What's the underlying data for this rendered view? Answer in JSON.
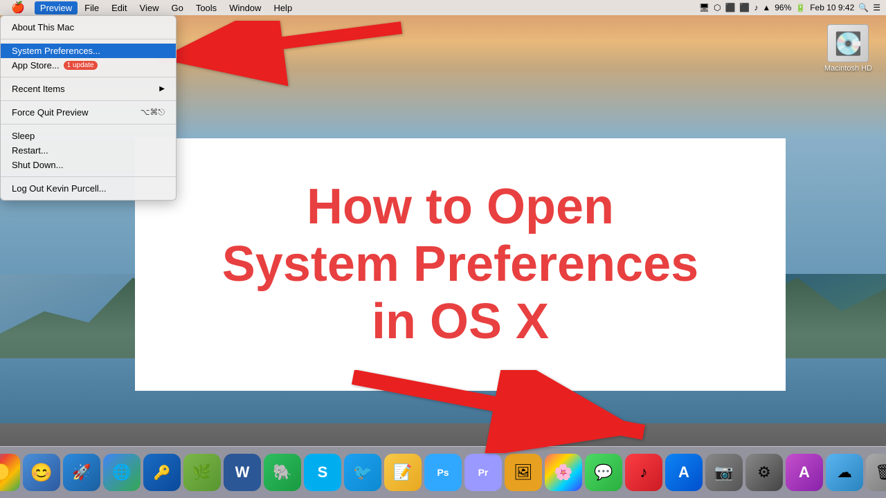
{
  "menubar": {
    "apple": "🍎",
    "appName": "Preview",
    "menus": [
      "File",
      "Edit",
      "View",
      "Go",
      "Tools",
      "Window",
      "Help"
    ],
    "right": {
      "monitor": "🖥",
      "bt": "●",
      "hid": "⬡",
      "clock10": "🕐",
      "screencast": "⬛",
      "audio": "♪",
      "wifi": "📶",
      "battery": "96%",
      "datetime": "Feb 10  9:42",
      "search": "🔍",
      "list": "☰"
    }
  },
  "appleMenu": {
    "items": [
      {
        "label": "About This Mac",
        "shortcut": "",
        "type": "item"
      },
      {
        "type": "divider"
      },
      {
        "label": "System Preferences...",
        "shortcut": "",
        "type": "item",
        "highlighted": true
      },
      {
        "label": "App Store...",
        "badge": "1 update",
        "type": "item"
      },
      {
        "type": "divider"
      },
      {
        "label": "Recent Items",
        "arrow": "▶",
        "type": "item"
      },
      {
        "type": "divider"
      },
      {
        "label": "Force Quit Preview",
        "shortcut": "⌥⌘⎋",
        "type": "item"
      },
      {
        "type": "divider"
      },
      {
        "label": "Sleep",
        "type": "item"
      },
      {
        "label": "Restart...",
        "type": "item"
      },
      {
        "label": "Shut Down...",
        "type": "item"
      },
      {
        "type": "divider"
      },
      {
        "label": "Log Out Kevin Purcell...",
        "type": "item"
      }
    ]
  },
  "tutorial": {
    "line1": "How to Open",
    "line2": "System Preferences",
    "line3": "in OS X"
  },
  "hdIcon": {
    "label": "Macintosh HD"
  },
  "dock": {
    "items": [
      {
        "id": "chrome-canary",
        "emoji": "🟡",
        "label": "Chrome Canary"
      },
      {
        "id": "finder",
        "emoji": "😊",
        "label": "Finder"
      },
      {
        "id": "launchpad",
        "emoji": "🚀",
        "label": "Launchpad"
      },
      {
        "id": "chrome",
        "emoji": "🌐",
        "label": "Chrome"
      },
      {
        "id": "portals",
        "emoji": "🔵",
        "label": "1Password"
      },
      {
        "id": "olive",
        "emoji": "🌿",
        "label": "Olive Tree"
      },
      {
        "id": "word",
        "emoji": "W",
        "label": "Word"
      },
      {
        "id": "evernote",
        "emoji": "🐘",
        "label": "Evernote"
      },
      {
        "id": "skype",
        "emoji": "S",
        "label": "Skype"
      },
      {
        "id": "twitter",
        "emoji": "🐦",
        "label": "Twitter"
      },
      {
        "id": "stickies",
        "emoji": "📝",
        "label": "Stickies"
      },
      {
        "id": "ps",
        "emoji": "Ps",
        "label": "Photoshop"
      },
      {
        "id": "pr",
        "emoji": "Pr",
        "label": "Premiere"
      },
      {
        "id": "master",
        "emoji": "🖼",
        "label": "Master"
      },
      {
        "id": "photos",
        "emoji": "🌸",
        "label": "Photos"
      },
      {
        "id": "messages",
        "emoji": "💬",
        "label": "Messages"
      },
      {
        "id": "itunes",
        "emoji": "♪",
        "label": "iTunes"
      },
      {
        "id": "appstore",
        "emoji": "A",
        "label": "App Store"
      },
      {
        "id": "iphoto",
        "emoji": "📷",
        "label": "iPhoto"
      },
      {
        "id": "sysprefs",
        "emoji": "⚙",
        "label": "System Preferences"
      },
      {
        "id": "launchpad2",
        "emoji": "A",
        "label": "Launchpad"
      },
      {
        "id": "icloud",
        "emoji": "☁",
        "label": "iCloud Drive"
      },
      {
        "id": "trash",
        "emoji": "🗑",
        "label": "Trash"
      }
    ]
  }
}
